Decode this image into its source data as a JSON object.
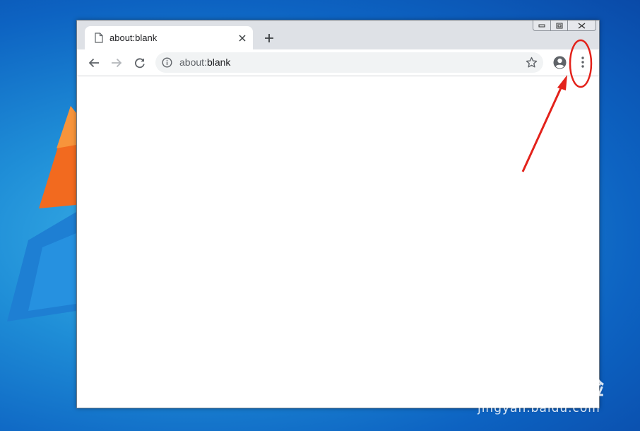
{
  "browser": {
    "tab": {
      "title": "about:blank"
    },
    "omnibox": {
      "url_scheme": "about:",
      "url_rest": "blank"
    }
  },
  "watermark": {
    "logo": "Bai du 经验",
    "site": "jingyan.baidu.com"
  },
  "colors": {
    "annotation": "#e3221b",
    "titlebar": "#dee1e6",
    "omnibox": "#f1f3f4",
    "icon": "#5f6368"
  },
  "icons": [
    "page-icon",
    "close-icon",
    "plus-icon",
    "back-arrow-icon",
    "forward-arrow-icon",
    "reload-icon",
    "info-icon",
    "star-icon",
    "profile-icon",
    "menu-dots-icon"
  ]
}
